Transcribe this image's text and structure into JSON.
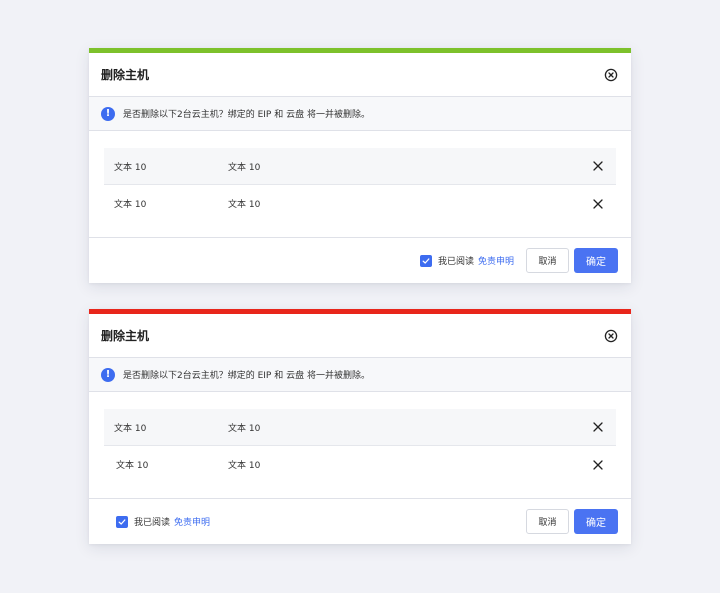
{
  "colors": {
    "success_bar": "#7dc12b",
    "danger_bar": "#e8261b",
    "accent": "#3d6cf0"
  },
  "dialogs": [
    {
      "title": "删除主机",
      "notice": "是否删除以下2台云主机？绑定的 EIP 和 云盘 将一并被删除。",
      "rows": [
        {
          "col1": "文本 10",
          "col2": "文本 10"
        },
        {
          "col1": "文本 10",
          "col2": "文本 10"
        }
      ],
      "agree_text": "我已阅读",
      "agree_link": "免责申明",
      "agree_checked": true,
      "cancel_label": "取消",
      "ok_label": "确定"
    },
    {
      "title": "删除主机",
      "notice": "是否删除以下2台云主机？绑定的 EIP 和 云盘 将一并被删除。",
      "rows": [
        {
          "col1": "文本 10",
          "col2": "文本 10"
        },
        {
          "col1": "文本 10",
          "col2": "文本 10"
        }
      ],
      "agree_text": "我已阅读",
      "agree_link": "免责申明",
      "agree_checked": true,
      "cancel_label": "取消",
      "ok_label": "确定"
    }
  ]
}
